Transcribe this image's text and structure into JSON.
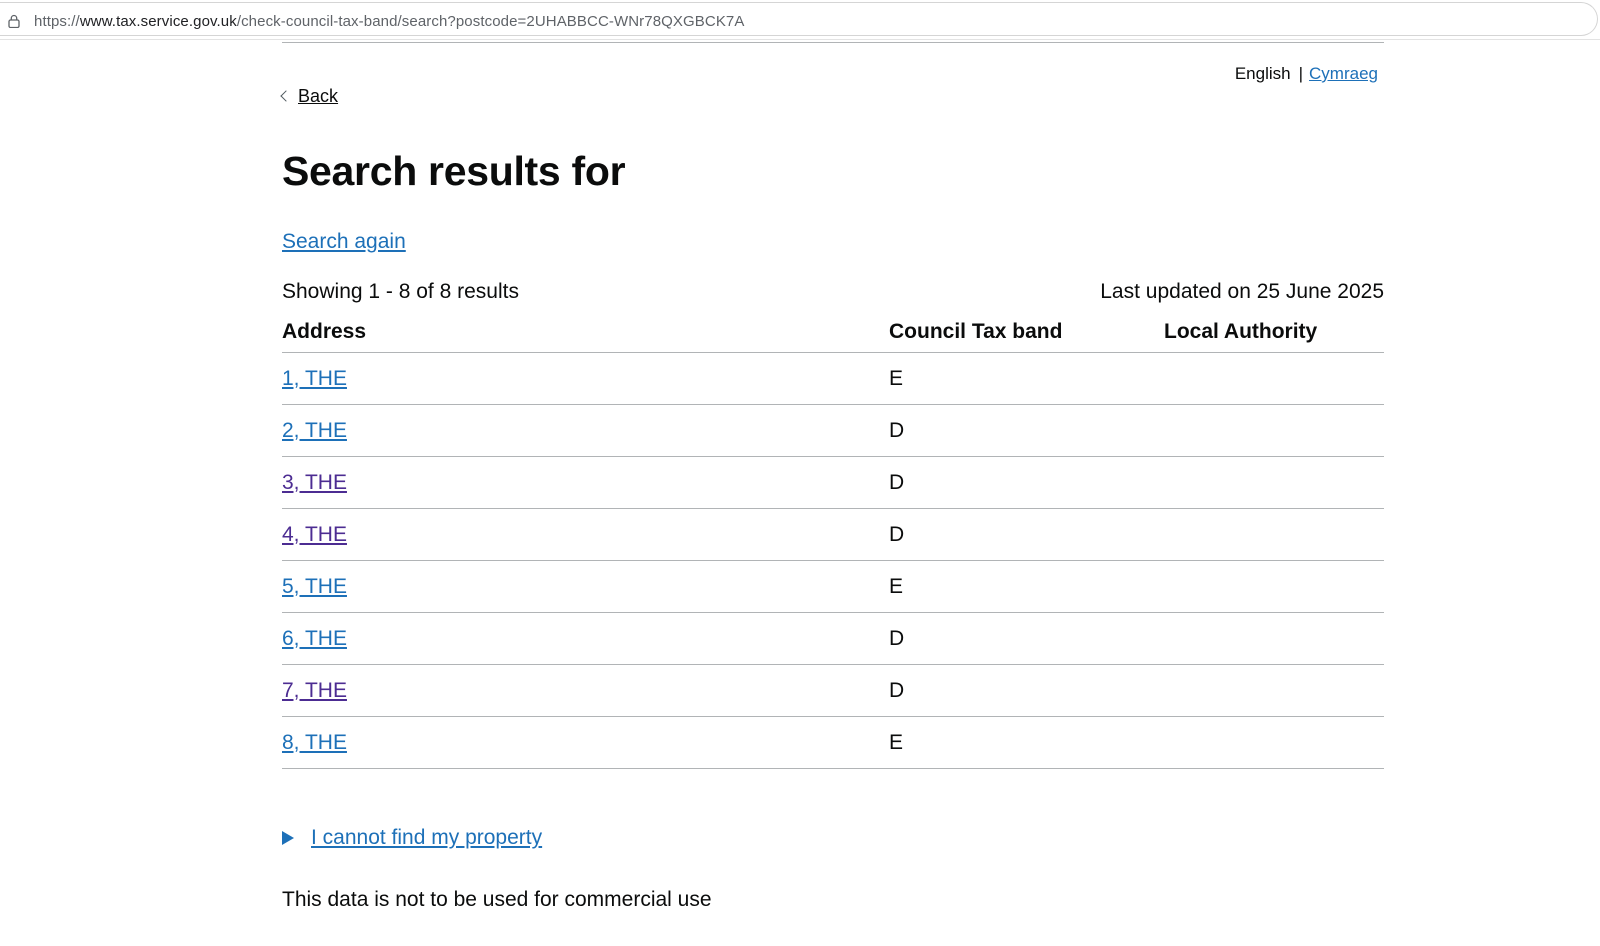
{
  "browser": {
    "url_prefix": "https://",
    "url_host": "www.tax.service.gov.uk",
    "url_path": "/check-council-tax-band/search?postcode=2UHABBCC-WNr78QXGBCK7A"
  },
  "language": {
    "current": "English",
    "separator": "|",
    "other": "Cymraeg"
  },
  "back_label": "Back",
  "page_title": "Search results for",
  "search_again": "Search again",
  "summary": {
    "showing": "Showing 1 - 8 of 8 results",
    "last_updated": "Last updated on 25 June 2025"
  },
  "table": {
    "headers": [
      "Address",
      "Council Tax band",
      "Local Authority"
    ],
    "rows": [
      {
        "address": "1, THE",
        "band": "E",
        "authority": "",
        "visited": false
      },
      {
        "address": "2, THE",
        "band": "D",
        "authority": "",
        "visited": false
      },
      {
        "address": "3, THE",
        "band": "D",
        "authority": "",
        "visited": true
      },
      {
        "address": "4, THE",
        "band": "D",
        "authority": "",
        "visited": true
      },
      {
        "address": "5, THE",
        "band": "E",
        "authority": "",
        "visited": false
      },
      {
        "address": "6, THE",
        "band": "D",
        "authority": "",
        "visited": false
      },
      {
        "address": "7, THE",
        "band": "D",
        "authority": "",
        "visited": true
      },
      {
        "address": "8, THE",
        "band": "E",
        "authority": "",
        "visited": false
      }
    ]
  },
  "details_summary": "I cannot find my property",
  "disclaimer": "This data is not to be used for commercial use",
  "colors": {
    "link": "#1d70b8",
    "link_visited": "#4c2c92",
    "text": "#0b0c0c",
    "border": "#b1b4b6"
  }
}
